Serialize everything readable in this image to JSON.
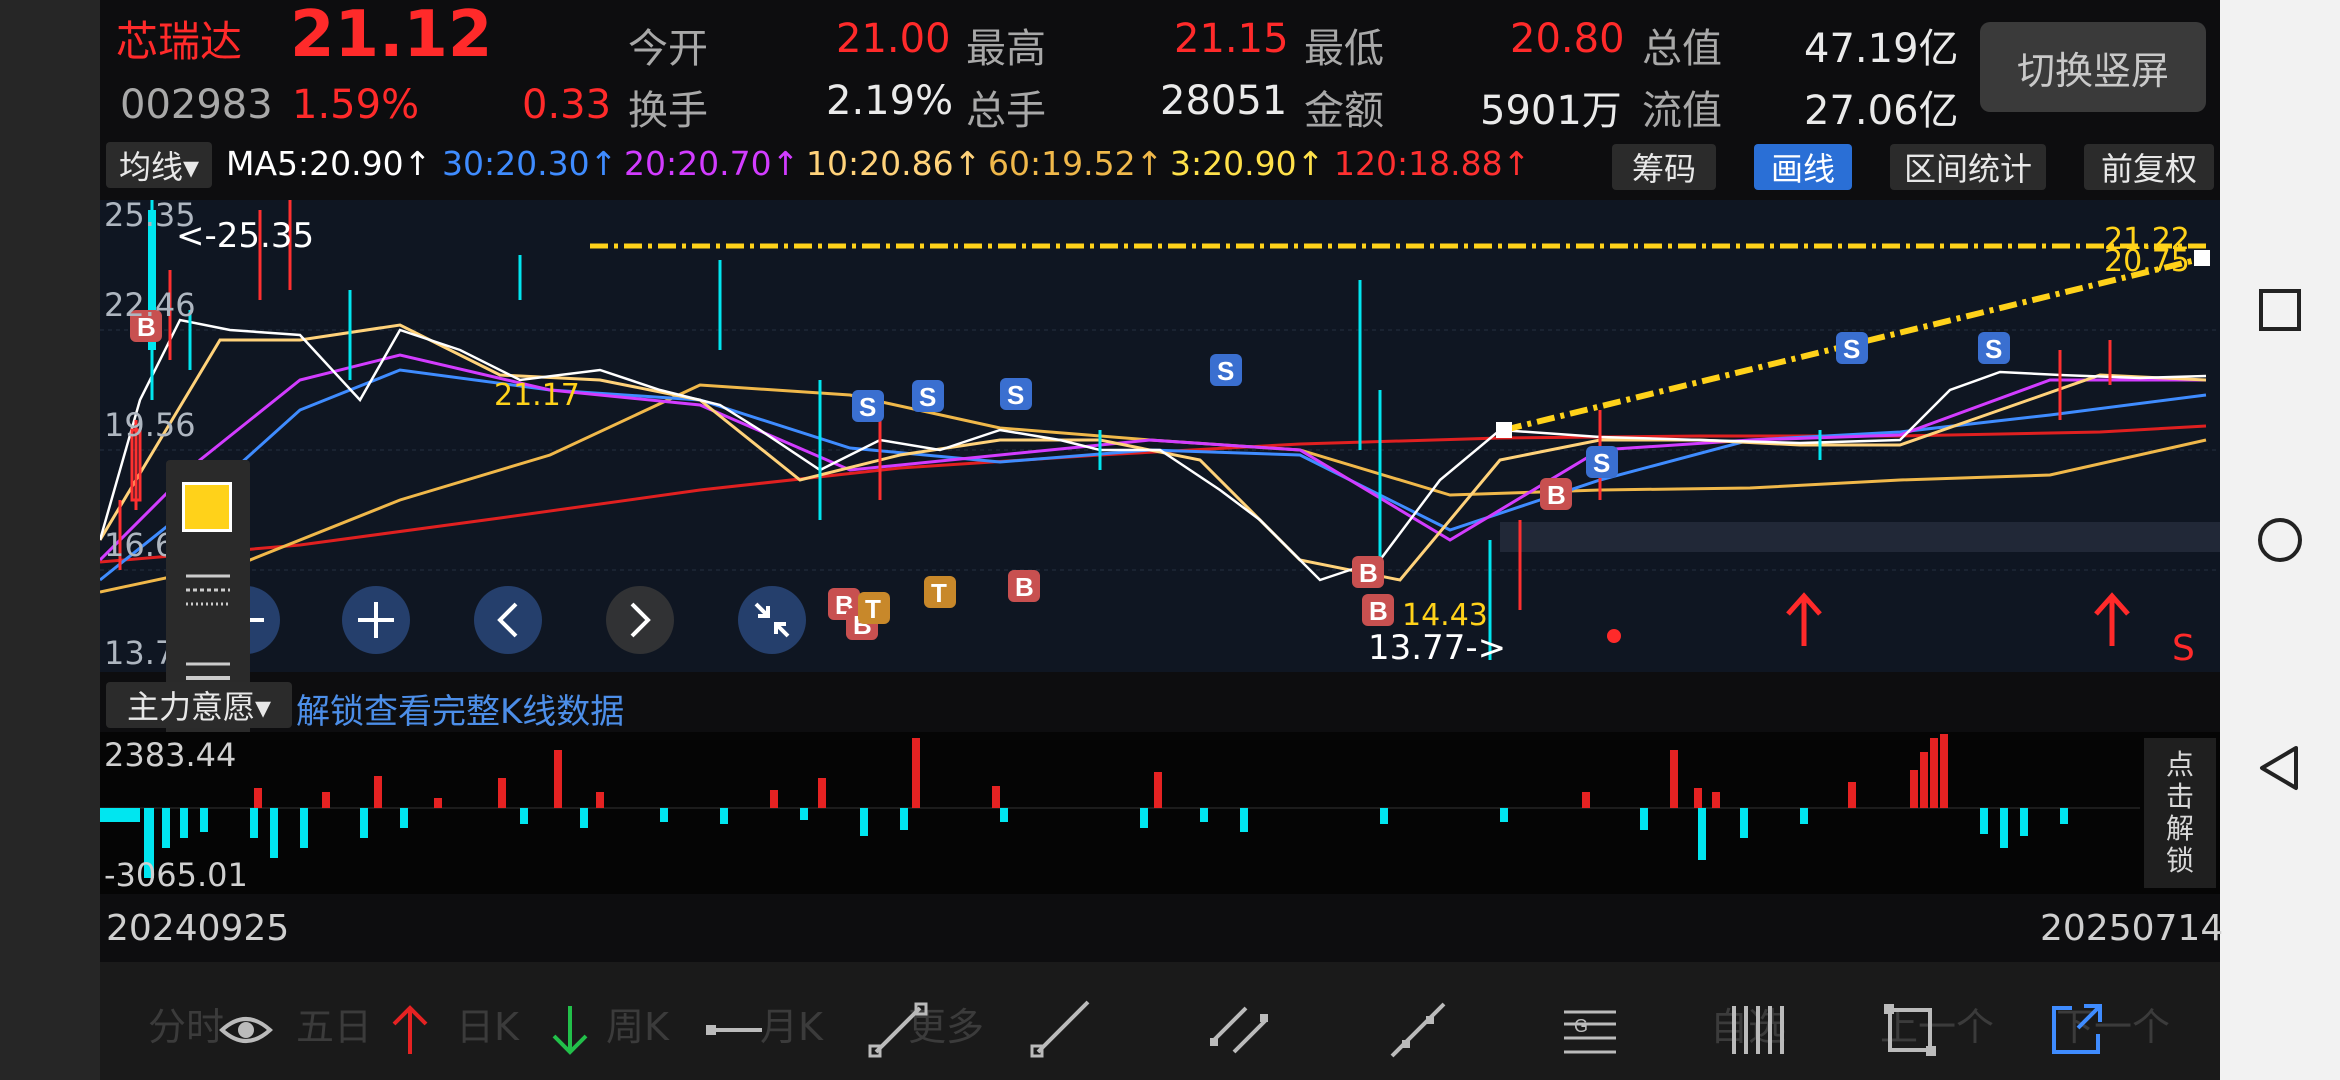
{
  "quote": {
    "name": "芯瑞达",
    "price": "21.12",
    "code": "002983",
    "change_pct": "1.59%",
    "change": "0.33",
    "open_label": "今开",
    "open": "21.00",
    "high_label": "最高",
    "high": "21.15",
    "low_label": "最低",
    "low": "20.80",
    "total_value_label": "总值",
    "total_value": "47.19亿",
    "turnover_label": "换手",
    "turnover": "2.19%",
    "volume_label": "总手",
    "volume": "28051",
    "amount_label": "金额",
    "amount": "5901万",
    "float_value_label": "流值",
    "float_value": "27.06亿"
  },
  "switch_button": "切换竖屏",
  "ma_bar": {
    "select_label": "均线▾",
    "ma5": "MA5:20.90↑",
    "ma30": "30:20.30↑",
    "ma20": "20:20.70↑",
    "ma10": "10:20.86↑",
    "ma60": "60:19.52↑",
    "ma3": "3:20.90↑",
    "ma120": "120:18.88↑",
    "colors": {
      "ma5": "#ffffff",
      "ma30": "#3f8cff",
      "ma20": "#d23cff",
      "ma10": "#ffd27a",
      "ma60": "#f0b84a",
      "ma3": "#ffe14a",
      "ma120": "#ff3030"
    }
  },
  "tools": {
    "chips": "筹码",
    "draw": "画线",
    "range_stats": "区间统计",
    "adjust": "前复权"
  },
  "kchart": {
    "y_labels": [
      "25.35",
      "22.46",
      "19.56",
      "16.66",
      "13.77"
    ],
    "max_marker": "<-25.35",
    "min_marker": "13.77->",
    "level_21_22": "21.22",
    "level_20_75": "20.75",
    "label_21_17": "21.17",
    "label_14_43": "14.43",
    "s_letter": "S"
  },
  "indicator": {
    "select_label": "主力意愿▾",
    "unlock_text": "解锁查看完整K线数据",
    "max": "2383.44",
    "min": "-3065.01",
    "side_unlock": [
      "点",
      "击",
      "解",
      "锁"
    ]
  },
  "dates": {
    "start": "20240925",
    "end": "20250714"
  },
  "toolbar_ghost": [
    "分时",
    "五日",
    "日K",
    "周K",
    "月K",
    "更多",
    "自选",
    "上一个",
    "下一个"
  ]
}
